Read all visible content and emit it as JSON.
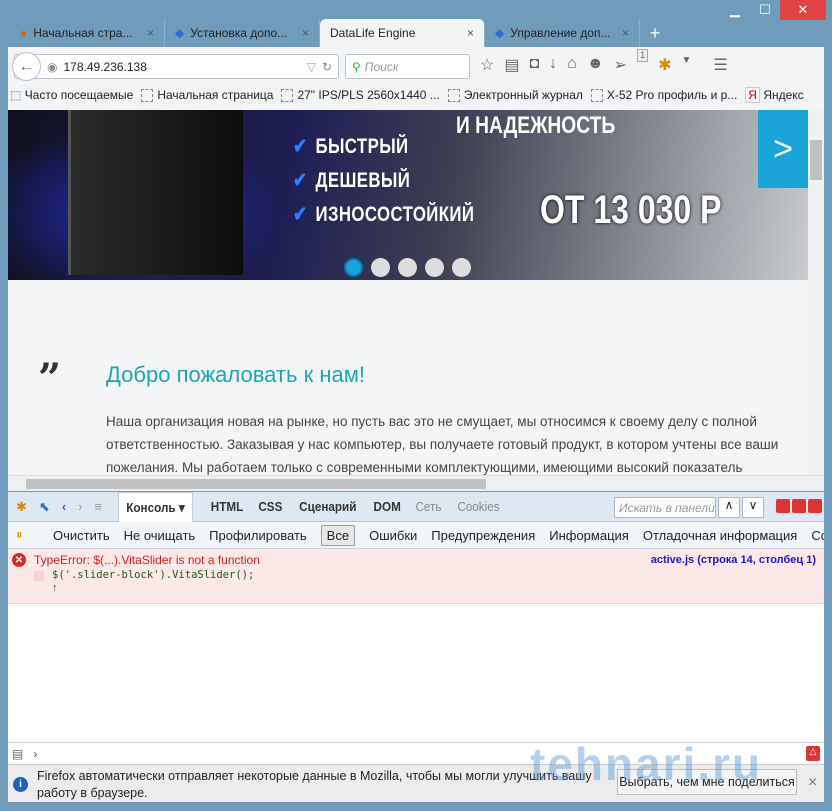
{
  "window": {
    "minimize": "▁",
    "maximize": "☐",
    "close": "✕"
  },
  "tabs": [
    {
      "title": "Начальная стра...",
      "close": "×"
    },
    {
      "title": "Установка допо...",
      "close": "×"
    },
    {
      "title": "DataLife Engine",
      "close": "×"
    },
    {
      "title": "Управление доп...",
      "close": "×"
    }
  ],
  "new_tab": "+",
  "toolbar": {
    "url": "178.49.236.138",
    "search_placeholder": "Поиск",
    "badge": "1"
  },
  "bookmarks": [
    "Часто посещаемые",
    "Начальная страница",
    "27\" IPS/PLS 2560x1440 ...",
    "Электронный журнал",
    "X-52 Pro профиль и р...",
    "Яндекс"
  ],
  "banner": {
    "headline": "И НАДЕЖНОСТЬ",
    "features": [
      "БЫСТРЫЙ",
      "ДЕШЕВЫЙ",
      "ИЗНОСОСТОЙКИЙ"
    ],
    "price": "ОТ 13 030 Р",
    "next": ">",
    "slides": 5,
    "active_slide": 1
  },
  "content": {
    "quote": "”",
    "title": "Добро пожаловать к нам!",
    "text": "Наша организация новая на рынке, но пусть вас это не смущает, мы относимся к своему делу с полной ответственностью. Заказывая у нас компьютер, вы получаете готовый продукт, в котором учтены все ваши пожелания. Мы работаем только с современными комплектующими, имеющими высокий показатель"
  },
  "devtools": {
    "panels": [
      "Консоль ▾",
      "HTML",
      "CSS",
      "Сценарий",
      "DOM",
      "Сеть",
      "Cookies"
    ],
    "search_placeholder": "Искать в панели",
    "filters": [
      "Очистить",
      "Не очищать",
      "Профилировать",
      "Все",
      "Ошибки",
      "Предупреждения",
      "Информация",
      "Отладочная информация",
      "Cookies"
    ],
    "error": {
      "message": "TypeError: $(...).VitaSlider is not a function",
      "source": "active.js (строка 14, столбец 1)",
      "code": "$('.slider-block').VitaSlider();"
    },
    "prompt": "›"
  },
  "notification": {
    "text": "Firefox автоматически отправляет некоторые данные в Mozilla, чтобы мы могли улучшить вашу работу в браузере.",
    "button": "Выбрать, чем мне поделиться",
    "close": "×"
  },
  "watermark": "tehnari.ru"
}
